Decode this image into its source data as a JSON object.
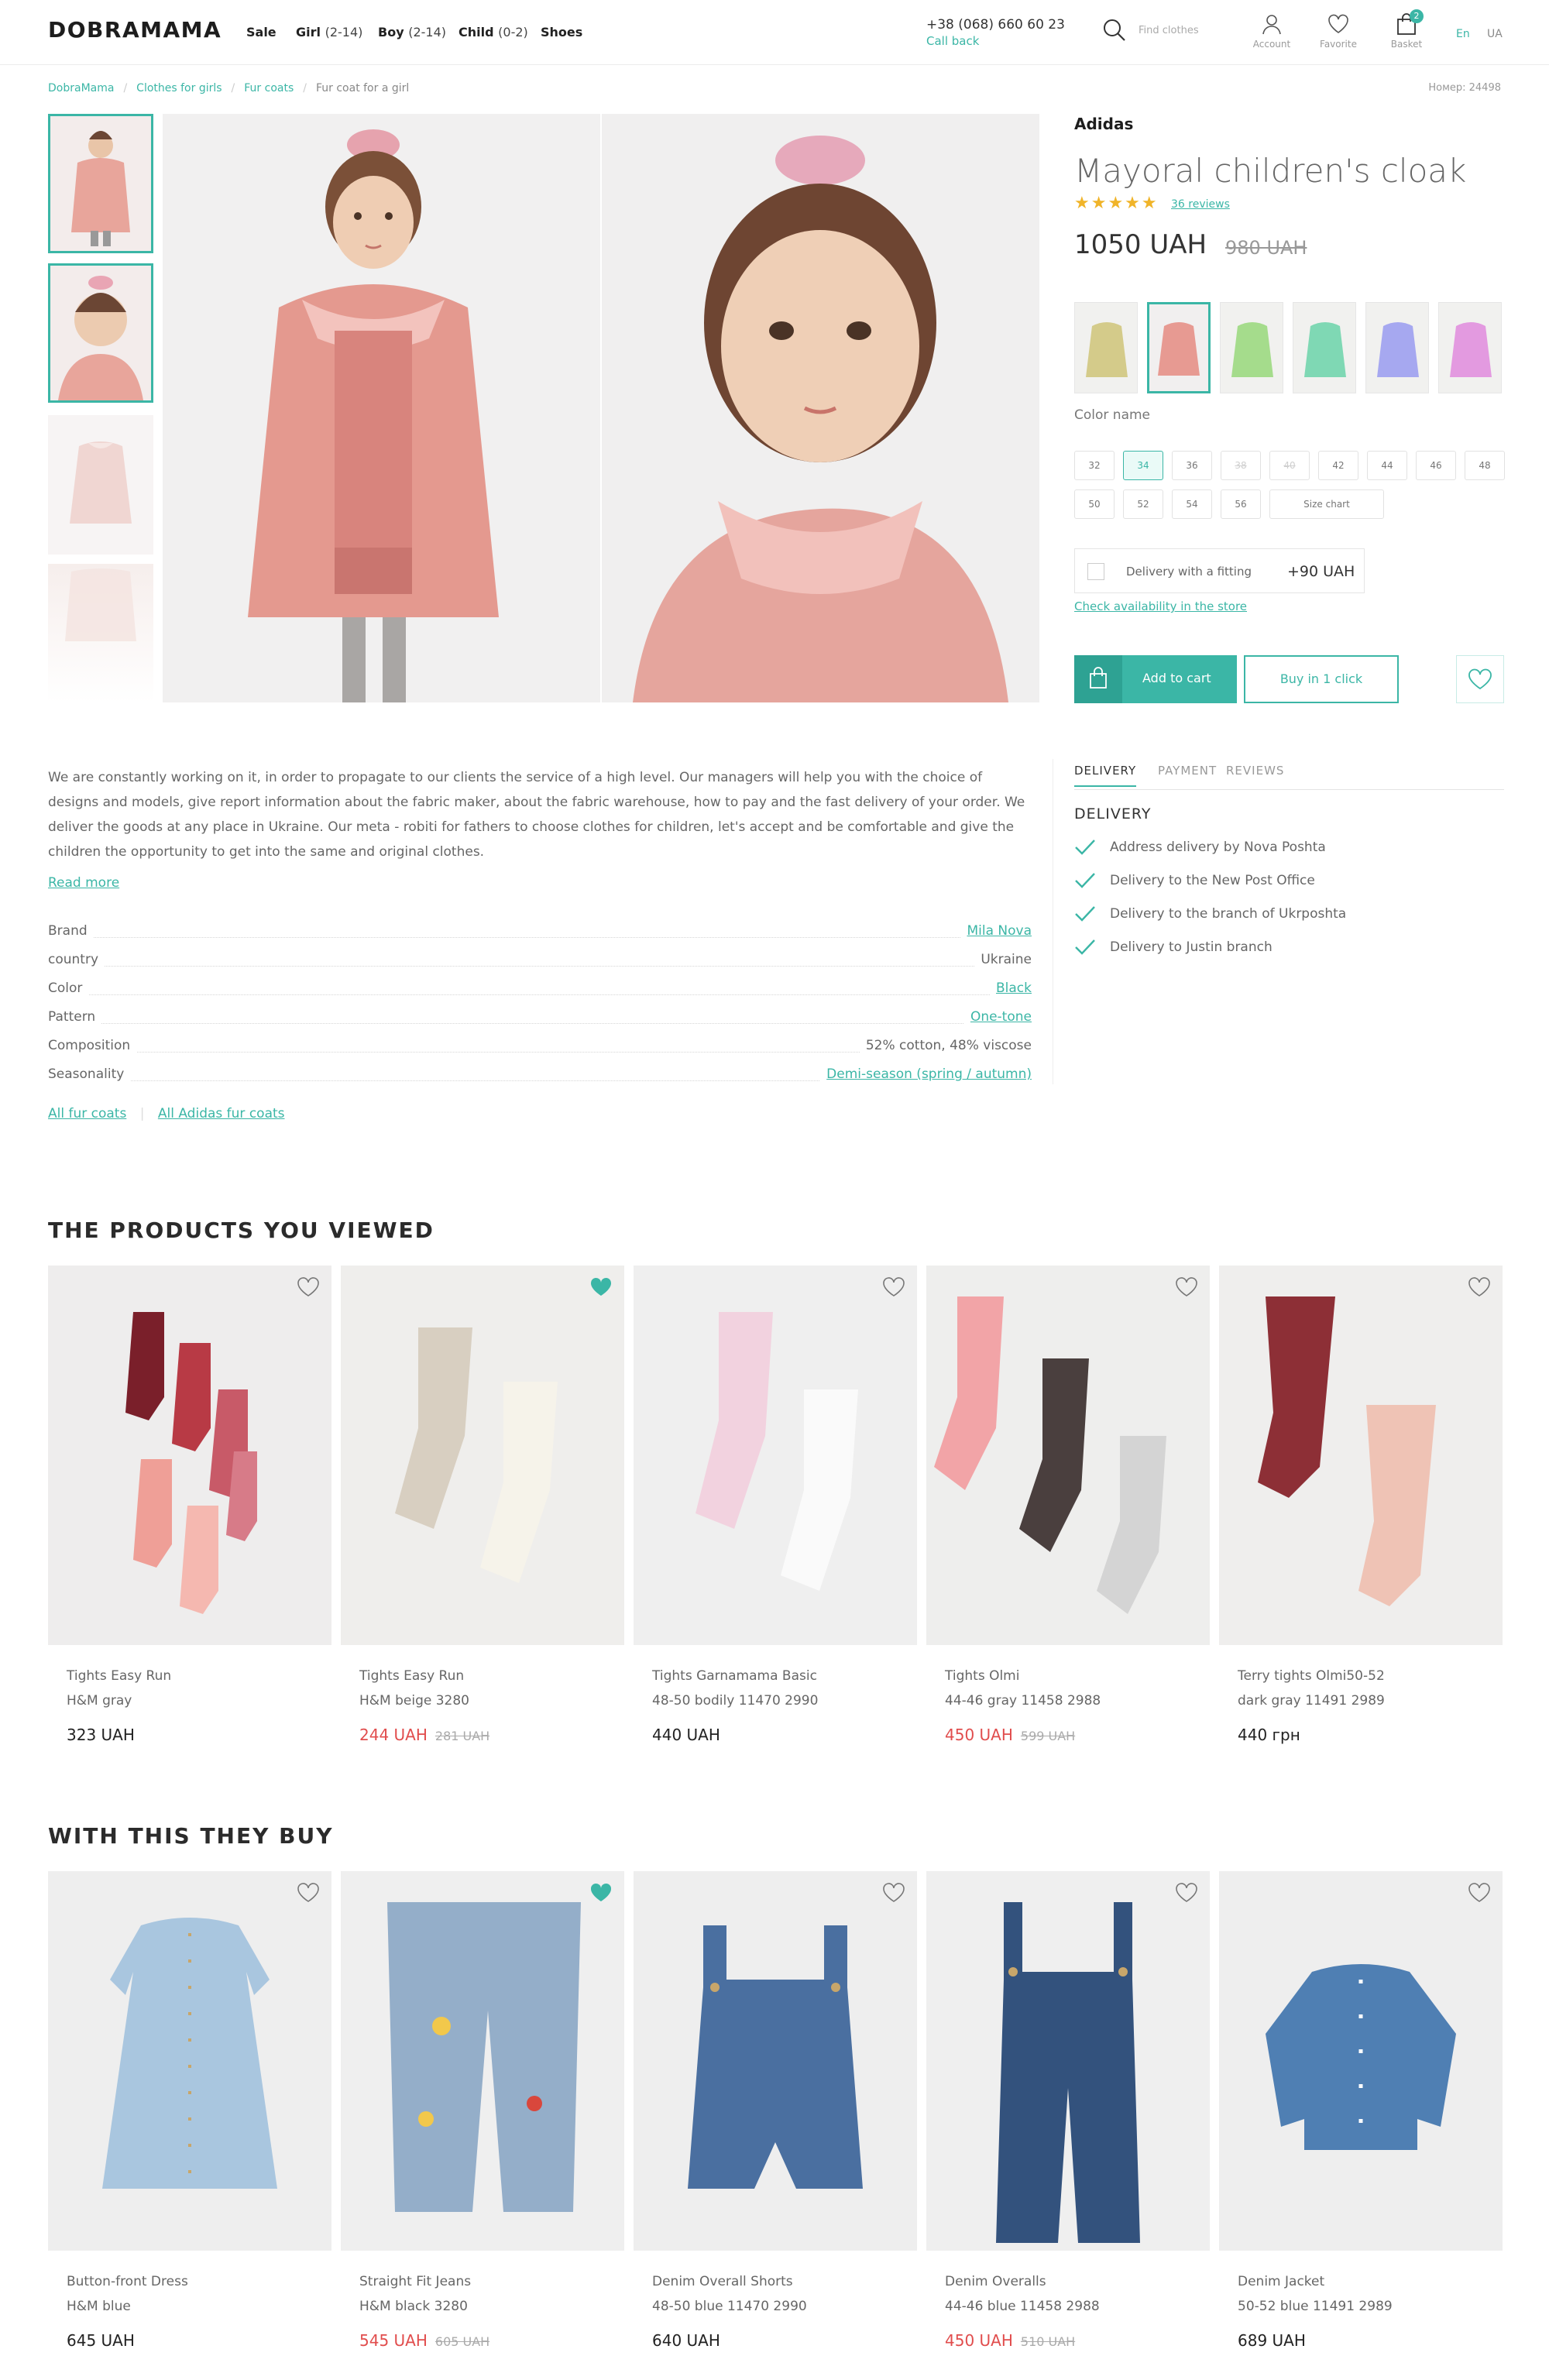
{
  "header": {
    "logo": "DOBRAMAMA",
    "nav": [
      {
        "label": "Sale",
        "age": ""
      },
      {
        "label": "Girl",
        "age": "(2-14)"
      },
      {
        "label": "Boy",
        "age": "(2-14)"
      },
      {
        "label": "Child",
        "age": "(0-2)"
      },
      {
        "label": "Shoes",
        "age": ""
      }
    ],
    "phone": "+38 (068) 660 60 23",
    "callback": "Call back",
    "search_placeholder": "Find clothes",
    "account_label": "Account",
    "favorite_label": "Favorite",
    "basket_label": "Basket",
    "basket_count": "2",
    "lang_en": "En",
    "lang_ua": "UA",
    "accent_color": "#3bb6a6",
    "sale_color": "#e14d4d"
  },
  "breadcrumbs": [
    "DobraMama",
    "Clothes for girls",
    "Fur coats",
    "Fur coat for a girl"
  ],
  "sku": "Номер: 24498",
  "product": {
    "brand": "Adidas",
    "title": "Mayoral children's cloak",
    "stars": "★★★★★",
    "reviews": "36 reviews",
    "price": "1050 UAH",
    "old_price": "980 UAH",
    "color_name": "Color name",
    "sizes": [
      "32",
      "34",
      "36",
      "38",
      "40",
      "42",
      "44",
      "46",
      "48",
      "50",
      "52",
      "54",
      "56"
    ],
    "selected_size": "34",
    "disabled_sizes": [
      "38",
      "40"
    ],
    "size_chart": "Size chart",
    "fitting_label": "Delivery with a fitting",
    "fitting_price": "+90 UAH",
    "check_availability": "Check availability in the store",
    "add_to_cart": "Add to cart",
    "buy_one_click": "Buy in 1 click"
  },
  "description": {
    "text": "We are constantly working on it, in order to propagate to our clients the service of a high level. Our managers will help you with the choice of designs and models, give report information about the fabric maker, about the fabric warehouse, how to pay and the fast delivery of your order. We deliver the goods at any place in Ukraine. Our meta - robiti for fathers to choose clothes for children, let's accept and be comfortable and give the children the opportunity to get into the same and original clothes.",
    "read_more": "Read more"
  },
  "specs": [
    {
      "key": "Brand",
      "value": "Mila Nova"
    },
    {
      "key": "country",
      "value": "Ukraine"
    },
    {
      "key": "Color",
      "value": "Black"
    },
    {
      "key": "Pattern",
      "value": "One-tone"
    },
    {
      "key": "Composition",
      "value": "52% cotton, 48% viscose"
    },
    {
      "key": "Seasonality",
      "value": "Demi-season (spring / autumn)"
    }
  ],
  "links": {
    "all_fur": "All fur coats",
    "all_brand": "All Adidas fur coats"
  },
  "delivery": {
    "tabs": [
      "DELIVERY",
      "PAYMENT",
      "REVIEWS"
    ],
    "heading": "DELIVERY",
    "items": [
      "Address delivery by Nova Poshta",
      "Delivery to the New Post Office",
      "Delivery to the branch of Ukrposhta",
      "Delivery to Justin branch"
    ]
  },
  "viewed": {
    "title": "THE PRODUCTS YOU VIEWED",
    "items": [
      {
        "name": "Tights Easy Run",
        "sub": " H&M gray",
        "price": "323 UAH",
        "old": "",
        "sale": false,
        "fav": false
      },
      {
        "name": "Tights Easy Run",
        "sub": "H&M beige 3280",
        "price": "244 UAH",
        "old": "281 UAH",
        "sale": true,
        "fav": true
      },
      {
        "name": "Tights Garnamama Basic",
        "sub": " 48-50 bodily 11470 2990",
        "price": "440 UAH",
        "old": "",
        "sale": false,
        "fav": false
      },
      {
        "name": "Tights Olmi",
        "sub": "44-46 gray 11458 2988",
        "price": "450 UAH",
        "old": "599 UAH",
        "sale": true,
        "fav": false
      },
      {
        "name": "Terry tights Olmi50-52",
        "sub": "dark gray 11491 2989",
        "price": "440 грн",
        "old": "",
        "sale": false,
        "fav": false
      }
    ]
  },
  "related": {
    "title": "WITH THIS THEY BUY",
    "items": [
      {
        "name": "Button-front Dress",
        "sub": "H&M blue",
        "price": "645 UAH",
        "old": "",
        "sale": false,
        "fav": false
      },
      {
        "name": "Straight Fit Jeans",
        "sub": " H&M black 3280",
        "price": "545 UAH",
        "old": "605 UAH",
        "sale": true,
        "fav": true
      },
      {
        "name": "Denim Overall Shorts",
        "sub": " 48-50 blue 11470 2990",
        "price": "640 UAH",
        "old": "",
        "sale": false,
        "fav": false
      },
      {
        "name": "Denim Overalls",
        "sub": "44-46 blue 11458 2988",
        "price": "450 UAH",
        "old": "510 UAH",
        "sale": true,
        "fav": false
      },
      {
        "name": "Denim Jacket",
        "sub": "50-52 blue 11491 2989",
        "price": "689 UAH",
        "old": "",
        "sale": false,
        "fav": false
      }
    ]
  }
}
